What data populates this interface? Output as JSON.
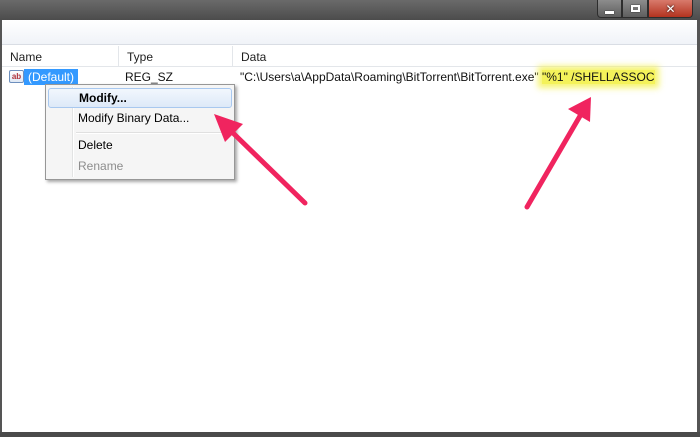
{
  "list": {
    "columns": {
      "name": "Name",
      "type": "Type",
      "data": "Data"
    },
    "rows": [
      {
        "icon": "string-value-icon",
        "icon_text": "ab",
        "name": "(Default)",
        "type": "REG_SZ",
        "data_main": "\"C:\\Users\\a\\AppData\\Roaming\\BitTorrent\\BitTorrent.exe\" ",
        "data_highlight": "\"%1\" /SHELLASSOC"
      }
    ]
  },
  "context_menu": {
    "items": [
      {
        "label": "Modify...",
        "state": "default-highlighted"
      },
      {
        "label": "Modify Binary Data...",
        "state": "enabled"
      },
      {
        "label": "Delete",
        "state": "enabled"
      },
      {
        "label": "Rename",
        "state": "disabled"
      }
    ]
  },
  "window": {
    "buttons": {
      "minimize": "minimize-icon",
      "maximize": "maximize-icon",
      "close": "close-icon",
      "close_glyph": "✕"
    }
  },
  "colors": {
    "selection": "#3399ff",
    "highlighter": "#f4f25a",
    "annotation_arrow": "#f0245f",
    "menu_hover": "#dde9f8"
  }
}
